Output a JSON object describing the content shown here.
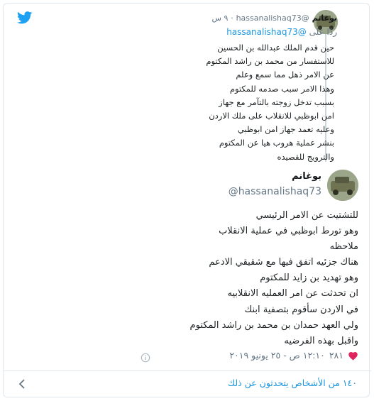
{
  "reply": {
    "name": "بوغانم",
    "handle": "@hassanalishaq73",
    "time": "٩ س",
    "replying_to_prefix": "ردًا على",
    "replying_to_handle": "@hassanalishaq73",
    "lines": [
      "حين قدم الملك عبدالله بن الحسين",
      "للاستفسار من محمد بن راشد المكتوم",
      "عن الامر ذهل مما سمع وعلم",
      "وهذا الامر سبب صدمه للمكتوم",
      "بسبب تدخل زوجته بالتآمر مع جهاز",
      "امن ابوظبي للانقلاب على ملك الاردن",
      "وعليه تعمد جهاز امن ابوظبي",
      "بنشر عملية هروب هيا عن المكتوم",
      "والترويج للقصيده"
    ]
  },
  "tweet": {
    "name": "بوغانم",
    "handle": "@hassanalishaq73",
    "lines": [
      "للتشتيت عن الامر الرئيسي",
      "وهو تورط ابوظبي في عملية الانقلاب",
      "ملاحظه",
      "هناك جزئيه اتفق فيها مع شقيقي الادعم",
      "وهو تهديد بن زايد للمكتوم",
      "ان تحدثت عن امر العمليه الانقلابيه",
      "في الاردن سأقوم بتصفية ابنك",
      "ولي العهد حمدان بن محمد بن راشد المكتوم",
      "واقبل بهذه الفرضيه"
    ],
    "likes": "٢٨١",
    "timestamp": "١٢:١٠ ص - ٢٥ يونيو ٢٠١٩"
  },
  "footer": {
    "people_talking": "١٤٠ من الأشخاص يتحدثون عن ذلك"
  },
  "icons": {
    "brand": "twitter-bird-icon",
    "like": "heart-icon",
    "info": "info-icon",
    "chevron": "chevron-left-icon"
  },
  "colors": {
    "accent": "#1da1f2",
    "link": "#1b95e0",
    "heart": "#e0245e",
    "muted": "#657786"
  }
}
